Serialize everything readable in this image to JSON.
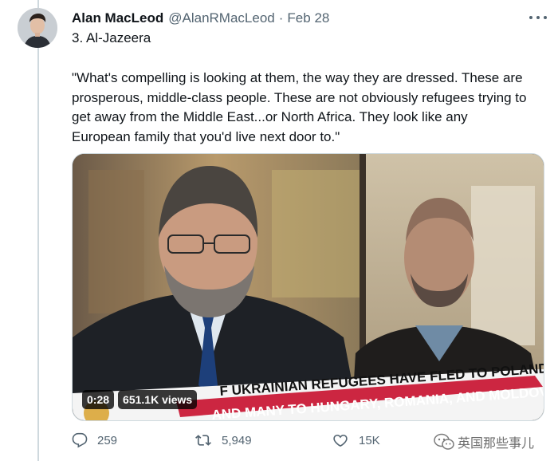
{
  "tweet": {
    "author_name": "Alan MacLeod",
    "handle": "@AlanRMacLeod",
    "separator": "·",
    "date": "Feb 28",
    "subtitle": "3. Al-Jazeera",
    "quote_lines": [
      "\"What's compelling is looking at them, the way they are dressed. These are",
      "prosperous, middle-class people. These are not obviously refugees trying to",
      "get away from the Middle East...or North Africa. They look like any",
      "European family that you'd live next door to.\""
    ]
  },
  "video": {
    "duration": "0:28",
    "views": "651.1K views",
    "ticker_line_1": "F UKRAINIAN REFUGEES HAVE FLED TO POLAND",
    "ticker_line_2": "AND MANY TO HUNGARY, ROMANIA, AND MOLDOVA",
    "ticker_color": "#c8102e"
  },
  "actions": {
    "replies": "259",
    "retweets": "5,949",
    "likes": "15K"
  },
  "watermark": {
    "text": "英国那些事儿"
  },
  "icons": {
    "more": "more-dots-icon",
    "reply": "reply-icon",
    "retweet": "retweet-icon",
    "like": "heart-icon",
    "watermark_logo": "wechat-icon"
  }
}
